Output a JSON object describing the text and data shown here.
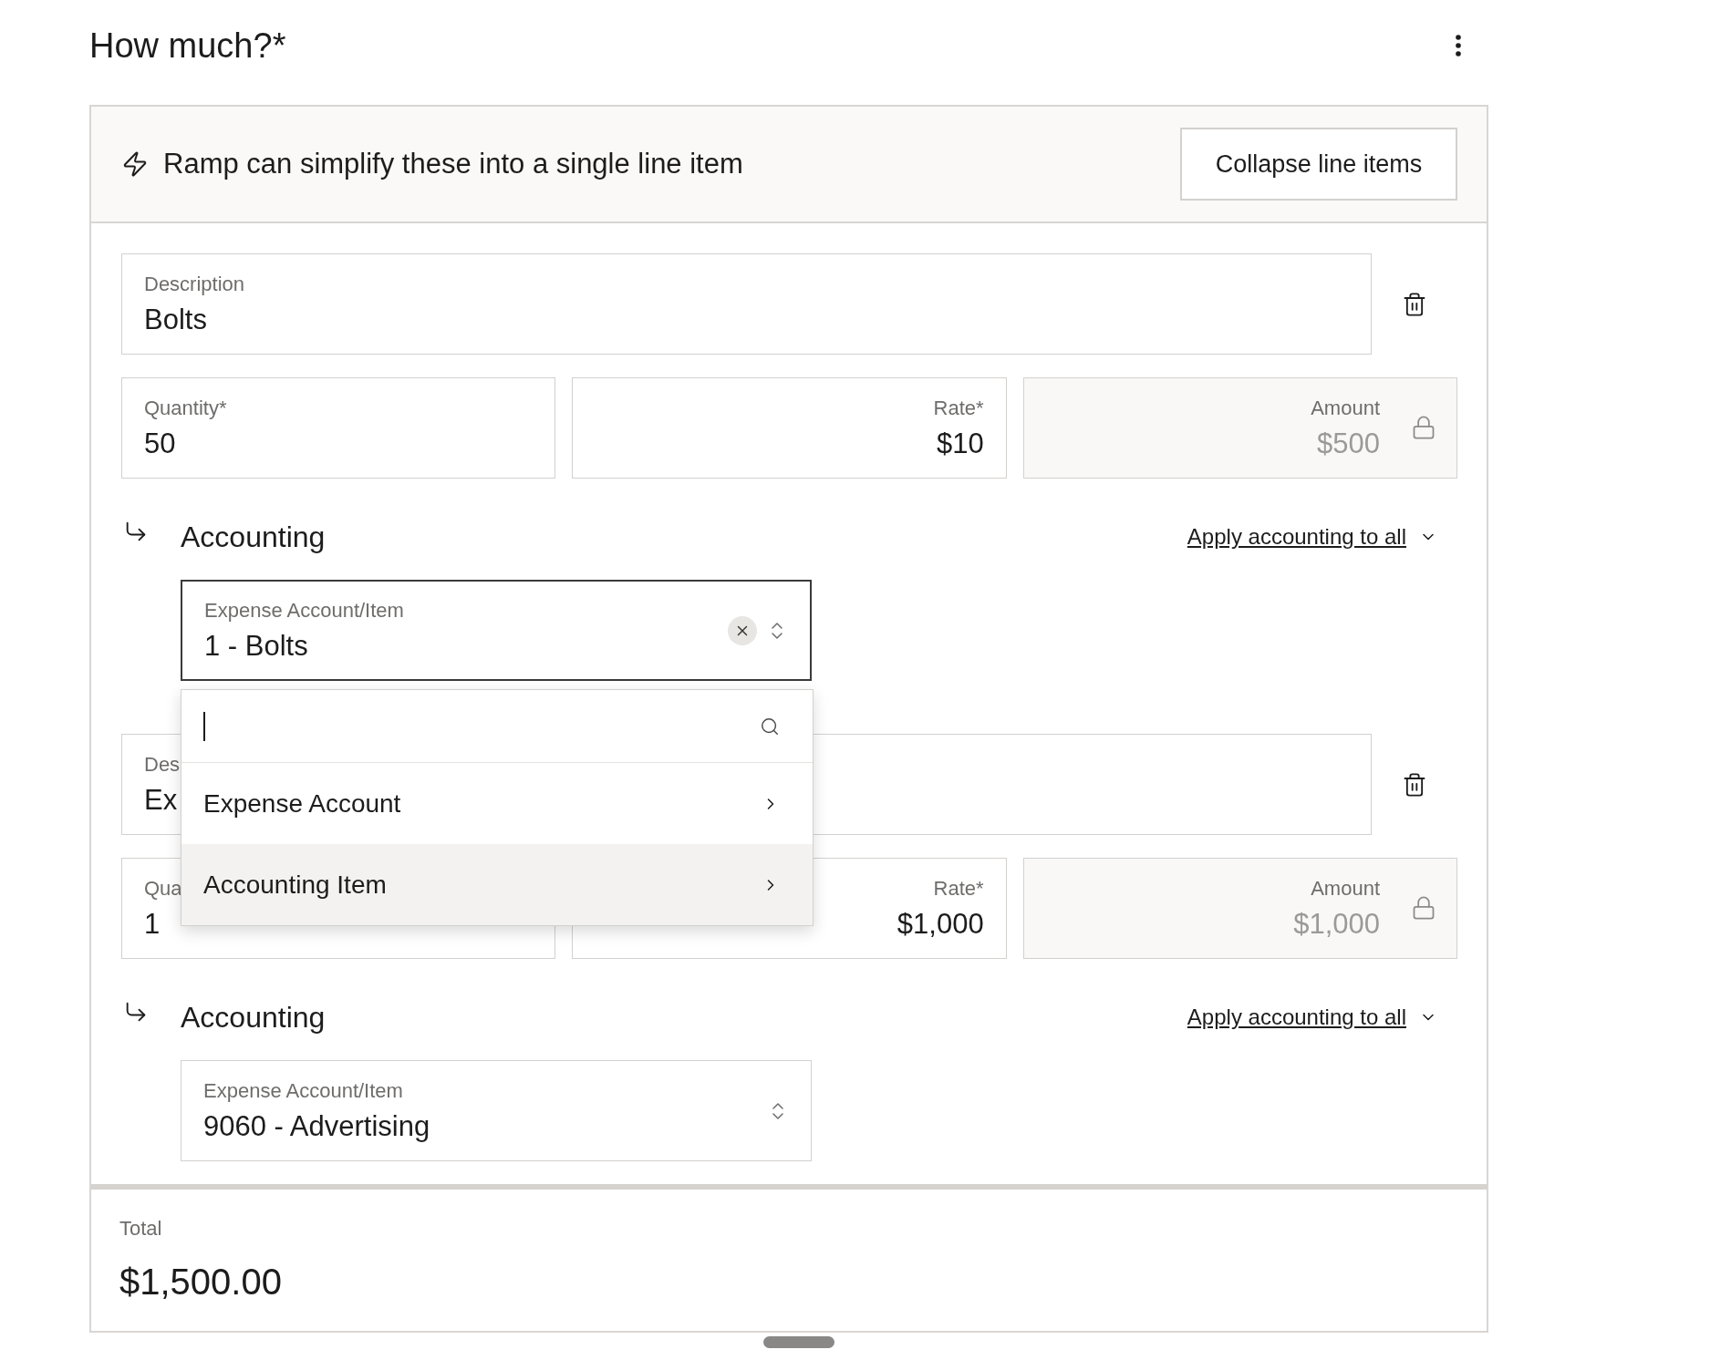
{
  "title": "How much?*",
  "banner": {
    "text": "Ramp can simplify these into a single line item",
    "button": "Collapse line items"
  },
  "line_items": [
    {
      "description": {
        "label": "Description",
        "value": "Bolts"
      },
      "quantity": {
        "label": "Quantity*",
        "value": "50"
      },
      "rate": {
        "label": "Rate*",
        "value": "$10"
      },
      "amount": {
        "label": "Amount",
        "value": "$500",
        "locked": true
      },
      "accounting": {
        "title": "Accounting",
        "apply_link": "Apply accounting to all",
        "select": {
          "label": "Expense Account/Item",
          "value": "1 - Bolts",
          "clearable": true,
          "focused": true,
          "menu": {
            "items": [
              {
                "label": "Expense Account",
                "selected": false
              },
              {
                "label": "Accounting Item",
                "selected": true
              }
            ]
          }
        }
      }
    },
    {
      "description": {
        "label": "Des",
        "value": "Ex"
      },
      "quantity": {
        "label": "Qua",
        "value": "1"
      },
      "rate": {
        "label": "Rate*",
        "value": "$1,000"
      },
      "amount": {
        "label": "Amount",
        "value": "$1,000",
        "locked": true
      },
      "accounting": {
        "title": "Accounting",
        "apply_link": "Apply accounting to all",
        "select": {
          "label": "Expense Account/Item",
          "value": "9060 - Advertising",
          "clearable": false,
          "focused": false
        }
      }
    }
  ],
  "total": {
    "label": "Total",
    "value": "$1,500.00"
  }
}
